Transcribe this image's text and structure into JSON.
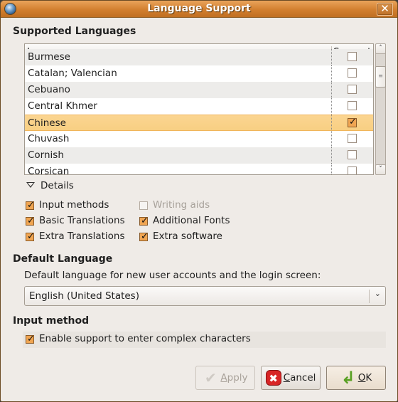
{
  "window": {
    "title": "Language Support",
    "icon": "globe-icon",
    "close_icon": "close-icon",
    "close_glyph": "✕"
  },
  "supported_languages": {
    "heading": "Supported Languages",
    "columns": {
      "language": "Language",
      "support": "Support"
    },
    "rows": [
      {
        "language": "Burmese",
        "supported": false,
        "partial": true
      },
      {
        "language": "Catalan; Valencian",
        "supported": false
      },
      {
        "language": "Cebuano",
        "supported": false
      },
      {
        "language": "Central Khmer",
        "supported": false
      },
      {
        "language": "Chinese",
        "supported": true,
        "selected": true
      },
      {
        "language": "Chuvash",
        "supported": false
      },
      {
        "language": "Cornish",
        "supported": false
      },
      {
        "language": "Corsican",
        "supported": false,
        "partial": true
      }
    ],
    "scrollbar": {
      "up_glyph": "˄",
      "down_glyph": "˅",
      "thumb_glyph": "≡"
    }
  },
  "details": {
    "label": "Details",
    "expanded": true,
    "options": [
      {
        "label": "Input methods",
        "checked": true,
        "enabled": true
      },
      {
        "label": "Writing aids",
        "checked": false,
        "enabled": false
      },
      {
        "label": "Basic Translations",
        "checked": true,
        "enabled": true
      },
      {
        "label": "Additional Fonts",
        "checked": true,
        "enabled": true
      },
      {
        "label": "Extra Translations",
        "checked": true,
        "enabled": true
      },
      {
        "label": "Extra software",
        "checked": true,
        "enabled": true
      }
    ]
  },
  "default_language": {
    "heading": "Default Language",
    "description": "Default language for new user accounts and the login screen:",
    "selected": "English (United States)",
    "dropdown_glyph": "⌄"
  },
  "input_method": {
    "heading": "Input method",
    "enable_label": "Enable support to enter complex characters",
    "enabled": true
  },
  "buttons": {
    "apply": {
      "label": "Apply",
      "mnemonic": "A",
      "rest": "pply",
      "enabled": false,
      "glyph": "✔"
    },
    "cancel": {
      "label": "Cancel",
      "mnemonic": "C",
      "rest": "ancel",
      "enabled": true,
      "glyph": "✖"
    },
    "ok": {
      "label": "OK",
      "mnemonic": "O",
      "rest": "K",
      "enabled": true,
      "glyph": "↲"
    }
  },
  "check_glyph": "✓"
}
